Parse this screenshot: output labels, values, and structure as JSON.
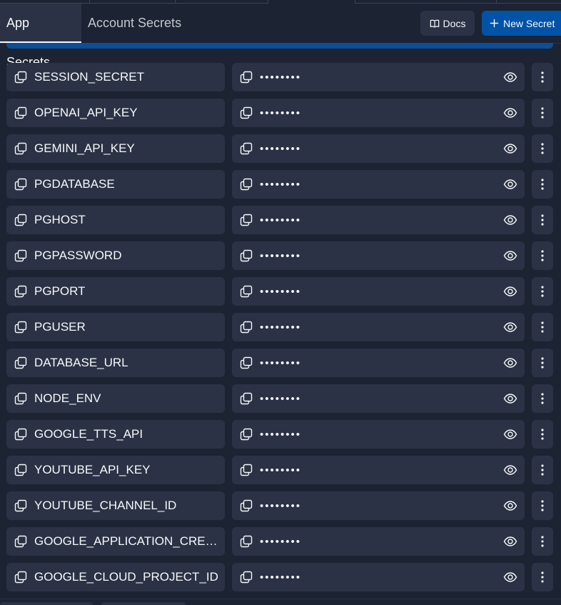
{
  "tabs": [
    {
      "label": "App Secrets",
      "active": true
    },
    {
      "label": "Account Secrets",
      "active": false
    }
  ],
  "actions": {
    "docs_label": "Docs",
    "new_secret_label": "New Secret"
  },
  "secrets": [
    {
      "key": "SESSION_SECRET",
      "value": "••••••••"
    },
    {
      "key": "OPENAI_API_KEY",
      "value": "••••••••"
    },
    {
      "key": "GEMINI_API_KEY",
      "value": "••••••••"
    },
    {
      "key": "PGDATABASE",
      "value": "••••••••"
    },
    {
      "key": "PGHOST",
      "value": "••••••••"
    },
    {
      "key": "PGPASSWORD",
      "value": "••••••••"
    },
    {
      "key": "PGPORT",
      "value": "••••••••"
    },
    {
      "key": "PGUSER",
      "value": "••••••••"
    },
    {
      "key": "DATABASE_URL",
      "value": "••••••••"
    },
    {
      "key": "NODE_ENV",
      "value": "••••••••"
    },
    {
      "key": "GOOGLE_TTS_API",
      "value": "••••••••"
    },
    {
      "key": "YOUTUBE_API_KEY",
      "value": "••••••••"
    },
    {
      "key": "YOUTUBE_CHANNEL_ID",
      "value": "••••••••"
    },
    {
      "key": "GOOGLE_APPLICATION_CRED...",
      "value": "••••••••"
    },
    {
      "key": "GOOGLE_CLOUD_PROJECT_ID",
      "value": "••••••••"
    }
  ],
  "icons": {
    "copy": "copy-icon",
    "eye": "eye-icon",
    "more": "more-vertical-icon",
    "book": "book-icon",
    "plus": "plus-icon"
  },
  "colors": {
    "background": "#1c2333",
    "surface": "#2b3245",
    "primary": "#0053a6",
    "text": "#f5f9fc",
    "muted": "#c2c8cc"
  }
}
